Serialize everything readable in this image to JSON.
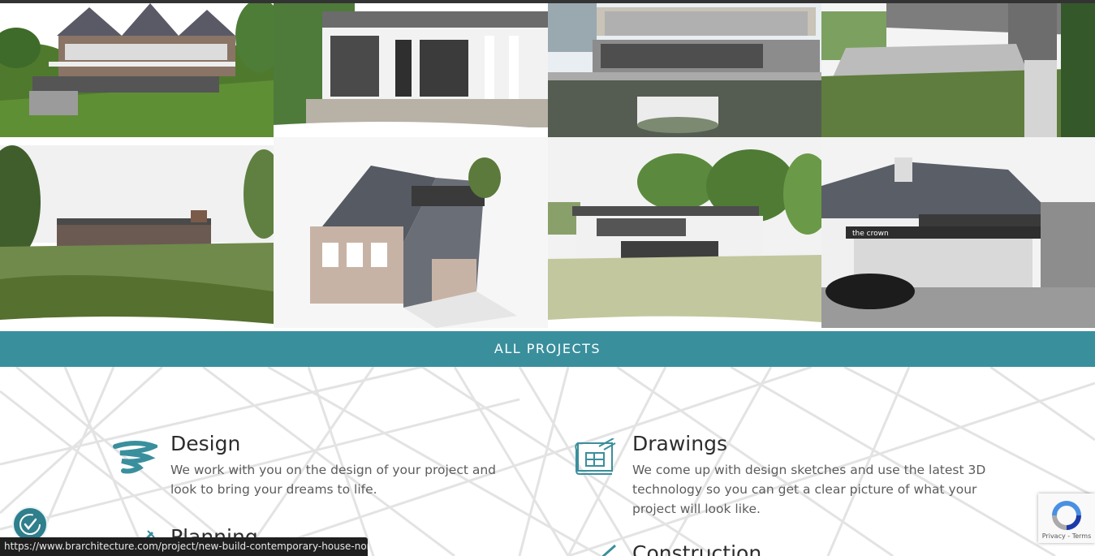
{
  "gallery": {
    "tiles": [
      {
        "name": "project-tile-1",
        "sky": "#ffffff",
        "ground": "#4f7a2e",
        "building": "#8a7466",
        "roof": "#5a5a66"
      },
      {
        "name": "project-tile-2",
        "sky": "#ffffff",
        "ground": "#b7b1a6",
        "building": "#f2f2f2",
        "roof": "#6b6b6b"
      },
      {
        "name": "project-tile-3",
        "sky": "#e8eef2",
        "ground": "#7c8a72",
        "building": "#c9c3b8",
        "roof": "#8c8c8c"
      },
      {
        "name": "project-tile-4",
        "sky": "#f4f4f4",
        "ground": "#5f7d3e",
        "building": "#bcbcbc",
        "roof": "#7d7d7d"
      },
      {
        "name": "project-tile-5",
        "sky": "#f1f1f1",
        "ground": "#6f8a4a",
        "building": "#6b5a52",
        "roof": "#4a4a4a"
      },
      {
        "name": "project-tile-6",
        "sky": "#f6f6f6",
        "ground": "#e6e6e6",
        "building": "#c7b3a5",
        "roof": "#555a63"
      },
      {
        "name": "project-tile-7",
        "sky": "#f2f2f2",
        "ground": "#c3c79d",
        "building": "#f1f1f1",
        "roof": "#4d4d4d"
      },
      {
        "name": "project-tile-8",
        "sky": "#f3f3f3",
        "ground": "#9a9a9a",
        "building": "#f0f0f0",
        "roof": "#5a5e66"
      }
    ],
    "car_label": "the crown"
  },
  "all_projects_label": "ALL PROJECTS",
  "services": [
    {
      "title": "Design",
      "text": "We work with you on the design of your project and look to bring your dreams to life.",
      "icon": "brush-stroke-icon"
    },
    {
      "title": "Drawings",
      "text": "We come up with design sketches and use the latest 3D technology so you can get a clear picture of what your project will look like.",
      "icon": "blueprint-icon"
    },
    {
      "title": "Planning",
      "text": "",
      "icon": "pen-icon"
    },
    {
      "title": "Construction",
      "text": "",
      "icon": "pencil-icon"
    }
  ],
  "status_url": "https://www.brarchitecture.com/project/new-build-contemporary-house-north-w...",
  "recaptcha": {
    "links": "Privacy - Terms"
  },
  "colors": {
    "accent": "#3a8f9d",
    "text": "#2d2d2d",
    "body": "#5c5c5c"
  }
}
